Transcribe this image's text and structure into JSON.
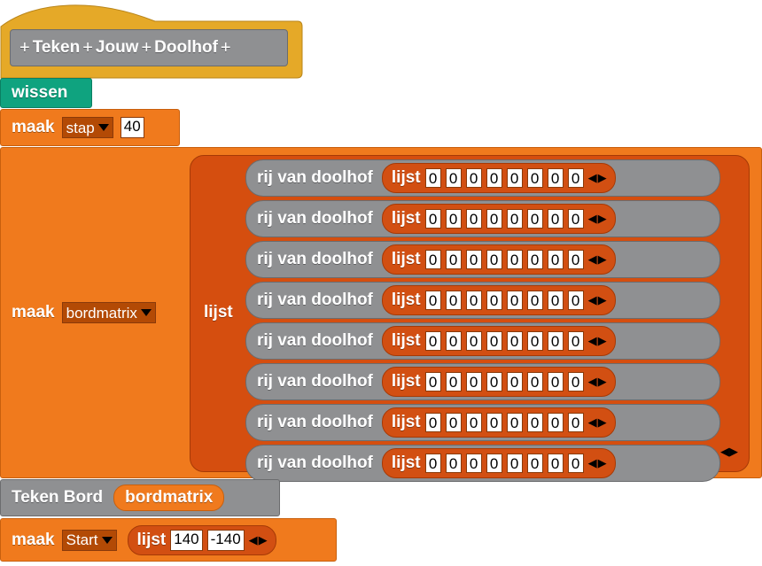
{
  "hat": {
    "title_words": [
      "Teken",
      "Jouw",
      "Doolhof"
    ],
    "plus": "+"
  },
  "wissen": {
    "label": "wissen"
  },
  "step": {
    "maak": "maak",
    "var": "stap",
    "value": "40"
  },
  "bord": {
    "maak": "maak",
    "var": "bordmatrix",
    "lijst": "lijst",
    "rows": [
      {
        "label": "rij van doolhof",
        "list_label": "lijst",
        "values": [
          "0",
          "0",
          "0",
          "0",
          "0",
          "0",
          "0",
          "0"
        ]
      },
      {
        "label": "rij van doolhof",
        "list_label": "lijst",
        "values": [
          "0",
          "0",
          "0",
          "0",
          "0",
          "0",
          "0",
          "0"
        ]
      },
      {
        "label": "rij van doolhof",
        "list_label": "lijst",
        "values": [
          "0",
          "0",
          "0",
          "0",
          "0",
          "0",
          "0",
          "0"
        ]
      },
      {
        "label": "rij van doolhof",
        "list_label": "lijst",
        "values": [
          "0",
          "0",
          "0",
          "0",
          "0",
          "0",
          "0",
          "0"
        ]
      },
      {
        "label": "rij van doolhof",
        "list_label": "lijst",
        "values": [
          "0",
          "0",
          "0",
          "0",
          "0",
          "0",
          "0",
          "0"
        ]
      },
      {
        "label": "rij van doolhof",
        "list_label": "lijst",
        "values": [
          "0",
          "0",
          "0",
          "0",
          "0",
          "0",
          "0",
          "0"
        ]
      },
      {
        "label": "rij van doolhof",
        "list_label": "lijst",
        "values": [
          "0",
          "0",
          "0",
          "0",
          "0",
          "0",
          "0",
          "0"
        ]
      },
      {
        "label": "rij van doolhof",
        "list_label": "lijst",
        "values": [
          "0",
          "0",
          "0",
          "0",
          "0",
          "0",
          "0",
          "0"
        ]
      }
    ],
    "arrows": "◀▶"
  },
  "draw": {
    "label": "Teken Bord",
    "arg": "bordmatrix"
  },
  "start": {
    "maak": "maak",
    "var": "Start",
    "lijst": "lijst",
    "values": [
      "140",
      "-140"
    ],
    "arrows": "◀▶"
  },
  "colors": {
    "orange": "#f07a1d",
    "dark_orange": "#d54e0f",
    "gray": "#8f9092",
    "green": "#0fa37f",
    "hat_yellow": "#e5a928"
  }
}
